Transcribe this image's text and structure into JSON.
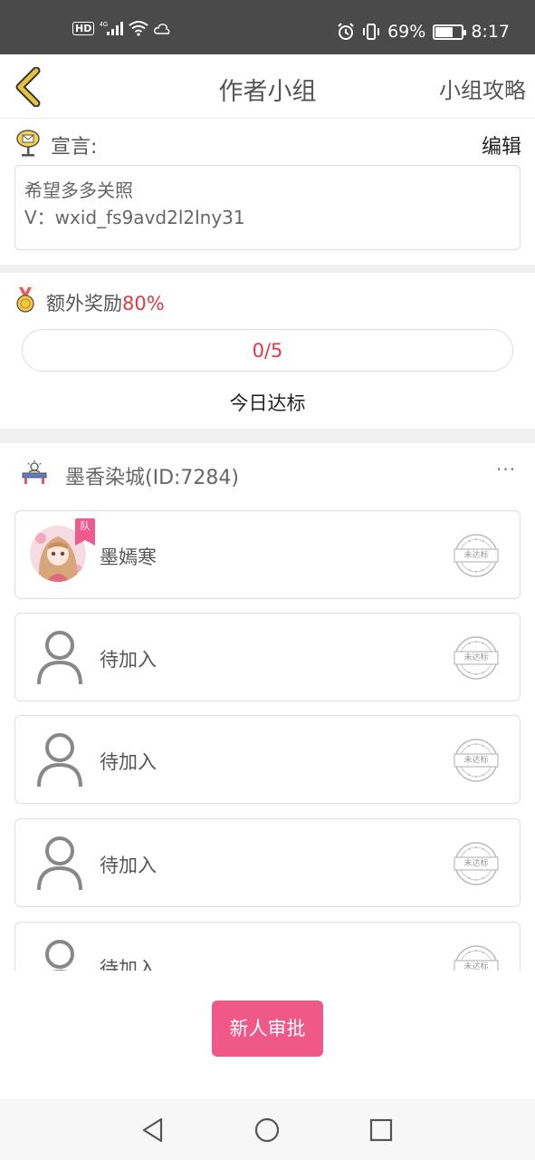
{
  "status_bar": {
    "hd_label": "HD",
    "network": "4G",
    "battery": "69%",
    "battery_level": 0.69,
    "time": "8:17"
  },
  "header": {
    "title": "作者小组",
    "guide_link": "小组攻略"
  },
  "declaration": {
    "label": "宣言:",
    "edit_label": "编辑",
    "lines": [
      "希望多多关照",
      "V：wxid_fs9avd2l2lny31"
    ]
  },
  "reward": {
    "label": "额外奖励",
    "percent": "80%",
    "progress_text": "0/5",
    "progress_value": 0,
    "progress_max": 5,
    "today_label": "今日达标"
  },
  "group": {
    "name": "墨香染城(ID:7284)",
    "more_label": "···"
  },
  "members": [
    {
      "name": "墨嫣寒",
      "is_leader": true,
      "badge": "队",
      "status": "未达标"
    },
    {
      "name": "待加入",
      "is_leader": false,
      "status": "未达标"
    },
    {
      "name": "待加入",
      "is_leader": false,
      "status": "未达标"
    },
    {
      "name": "待加入",
      "is_leader": false,
      "status": "未达标"
    },
    {
      "name": "待加入",
      "is_leader": false,
      "status": "未达标"
    }
  ],
  "approve_button": "新人审批",
  "colors": {
    "accent_pink": "#f0588a",
    "reward_red": "#e03a4a",
    "back_arrow_gold": "#c9a227"
  }
}
